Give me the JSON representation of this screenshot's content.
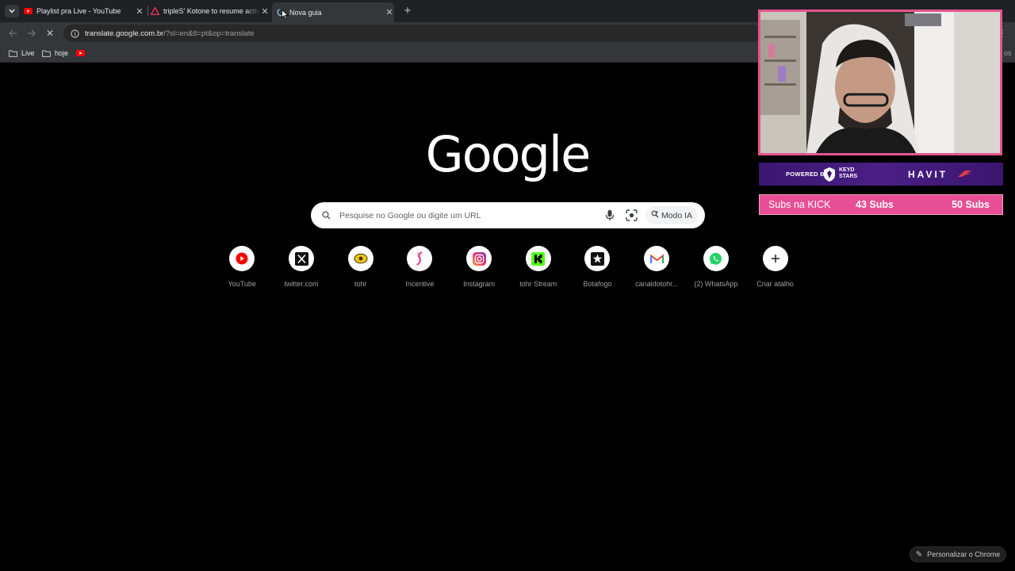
{
  "tabs": [
    {
      "title": "Playlist pra Live - YouTube",
      "icon": "youtube-icon",
      "active": false
    },
    {
      "title": "tripleS' Kotone to resume activ",
      "icon": "warning-icon",
      "active": false
    },
    {
      "title": "Nova guia",
      "icon": "loading-icon",
      "active": true
    }
  ],
  "toolbar": {
    "url_host": "translate.google.com.br",
    "url_path": "/?sl=en&tl=pt&op=translate"
  },
  "bookmarks": [
    {
      "label": "Live",
      "icon": "folder-icon"
    },
    {
      "label": "hoje",
      "icon": "folder-icon"
    },
    {
      "label": "",
      "icon": "youtube-icon"
    }
  ],
  "google": {
    "logo": "Google",
    "search_placeholder": "Pesquise no Google ou digite um URL",
    "ai_mode_label": "Modo IA"
  },
  "shortcuts": [
    {
      "label": "YouTube",
      "icon": "youtube-icon"
    },
    {
      "label": "twitter.com",
      "icon": "x-icon"
    },
    {
      "label": "tohr",
      "icon": "tohr-icon"
    },
    {
      "label": "Incentive",
      "icon": "incentive-icon"
    },
    {
      "label": "Instagram",
      "icon": "instagram-icon"
    },
    {
      "label": "tohr Stream",
      "icon": "kick-icon"
    },
    {
      "label": "Botafogo",
      "icon": "botafogo-star-icon"
    },
    {
      "label": "canaldotohr...",
      "icon": "gmail-icon"
    },
    {
      "label": "(2) WhatsApp",
      "icon": "whatsapp-icon"
    },
    {
      "label": "Criar atalho",
      "icon": "plus-icon"
    }
  ],
  "customize_label": "Personalizar o Chrome",
  "overlay": {
    "sponsor_powered": "POWERED BY",
    "sponsor_brand1_line1": "KEYD",
    "sponsor_brand1_line2": "STARS",
    "sponsor_brand2": "HAVIT",
    "subs_goal_label": "Subs na KICK",
    "subs_current": "43 Subs",
    "subs_target": "50 Subs"
  },
  "colors": {
    "accent_pink": "#e64f95",
    "sponsor_purple": "#4a1f86",
    "youtube_red": "#ff0000",
    "kick_green": "#53fc18"
  }
}
